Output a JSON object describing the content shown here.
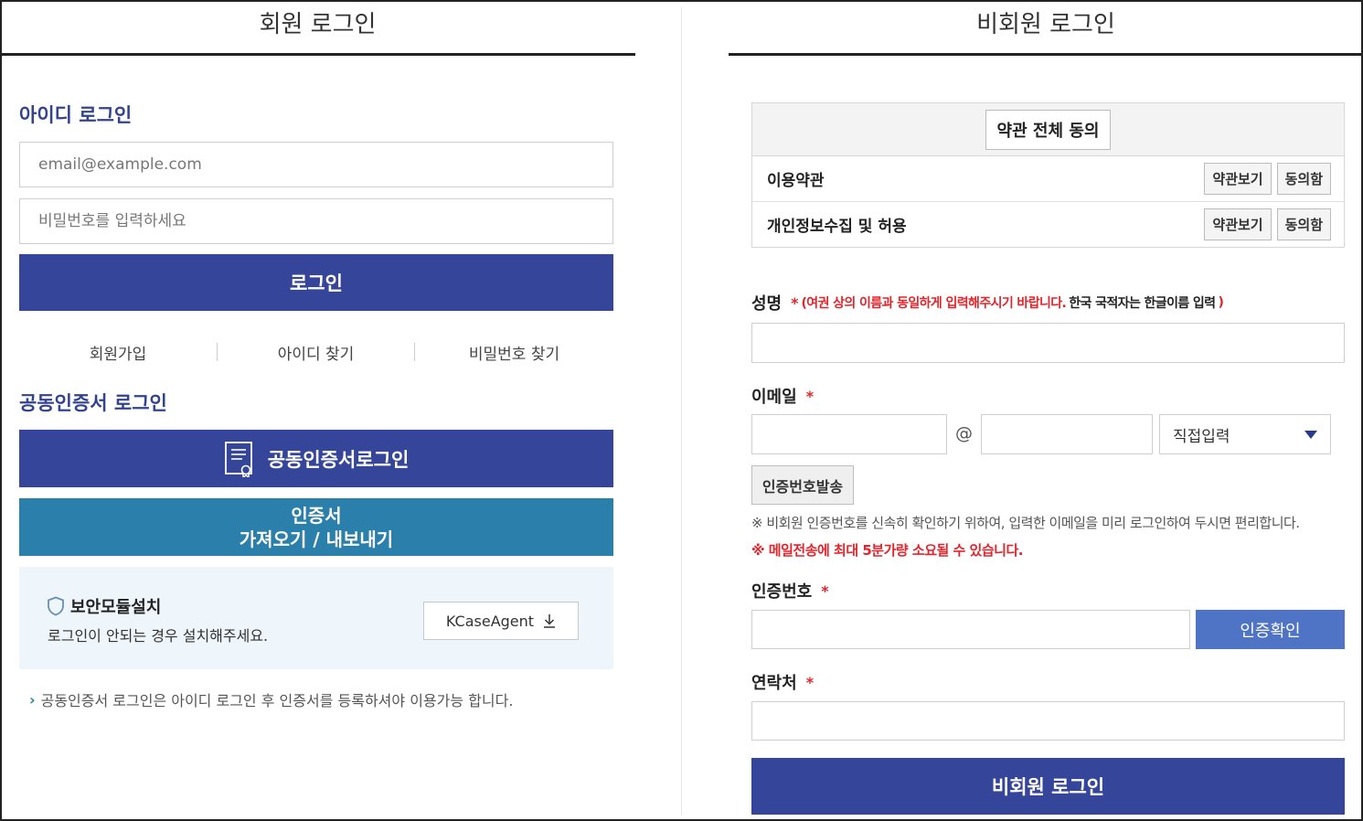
{
  "member": {
    "title": "회원 로그인",
    "id_section_title": "아이디 로그인",
    "email_placeholder": "email@example.com",
    "password_placeholder": "비밀번호를 입력하세요",
    "login_button": "로그인",
    "links": [
      "회원가입",
      "아이디 찾기",
      "비밀번호 찾기"
    ],
    "cert_section_title": "공동인증서 로그인",
    "cert_login_button": "공동인증서로그인",
    "cert_transfer_line1": "인증서",
    "cert_transfer_line2": "가져오기 / 내보내기",
    "security": {
      "title": "보안모듈설치",
      "desc": "로그인이 안되는 경우 설치해주세요.",
      "button": "KCaseAgent"
    },
    "note": "공동인증서 로그인은 아이디 로그인 후 인증서를 등록하셔야 이용가능 합니다."
  },
  "guest": {
    "title": "비회원 로그인",
    "agree_all": "약관 전체 동의",
    "terms": [
      {
        "label": "이용약관",
        "view": "약관보기",
        "agree": "동의함"
      },
      {
        "label": "개인정보수집 및 허용",
        "view": "약관보기",
        "agree": "동의함"
      }
    ],
    "required_mark": "*",
    "name_label": "성명",
    "name_hint_red": "(여권 상의 이름과 동일하게 입력해주시기 바랍니다.",
    "name_hint_black": "한국 국적자는 한글이름 입력",
    "name_hint_close": ")",
    "email_label": "이메일",
    "email_at": "@",
    "email_domain_select": "직접입력",
    "send_code_button": "인증번호발송",
    "info_gray": "※ 비회원 인증번호를 신속히 확인하기 위하여, 입력한 이메일을 미리 로그인하여 두시면 편리합니다.",
    "info_red": "※ 메일전송에 최대 5분가량 소요될 수 있습니다.",
    "code_label": "인증번호",
    "confirm_button": "인증확인",
    "phone_label": "연락처",
    "guest_login_button": "비회원 로그인"
  },
  "colors": {
    "navy": "#35469a",
    "teal": "#2b7fab",
    "confirm_blue": "#5074c5",
    "required_red": "#e3242b",
    "security_bg": "#eef5fb"
  }
}
